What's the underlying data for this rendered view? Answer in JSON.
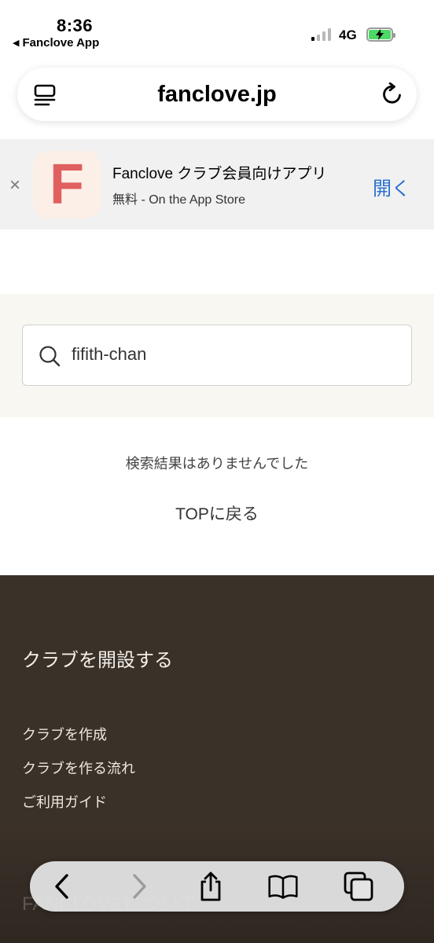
{
  "status_bar": {
    "time": "8:36",
    "back_app": "Fanclove App",
    "network": "4G"
  },
  "url_bar": {
    "url": "fanclove.jp"
  },
  "app_banner": {
    "icon_letter": "F",
    "app_name": "Fanclove クラブ会員向けアプリ",
    "subtitle": "無料 - On the App Store",
    "open_label": "開く",
    "close_label": "×"
  },
  "search": {
    "value": "fifith-chan"
  },
  "results": {
    "empty_message": "検索結果はありませんでした",
    "back_to_top": "TOPに戻る"
  },
  "footer": {
    "heading": "クラブを開設する",
    "links": [
      "クラブを作成",
      "クラブを作る流れ",
      "ご利用ガイド"
    ],
    "partial_heading": "FANCLOVEについて"
  },
  "colors": {
    "accent_blue": "#2a6fd0",
    "app_icon_red": "#e06060",
    "footer_bg": "#3a3129",
    "search_bg": "#f8f7f1"
  }
}
